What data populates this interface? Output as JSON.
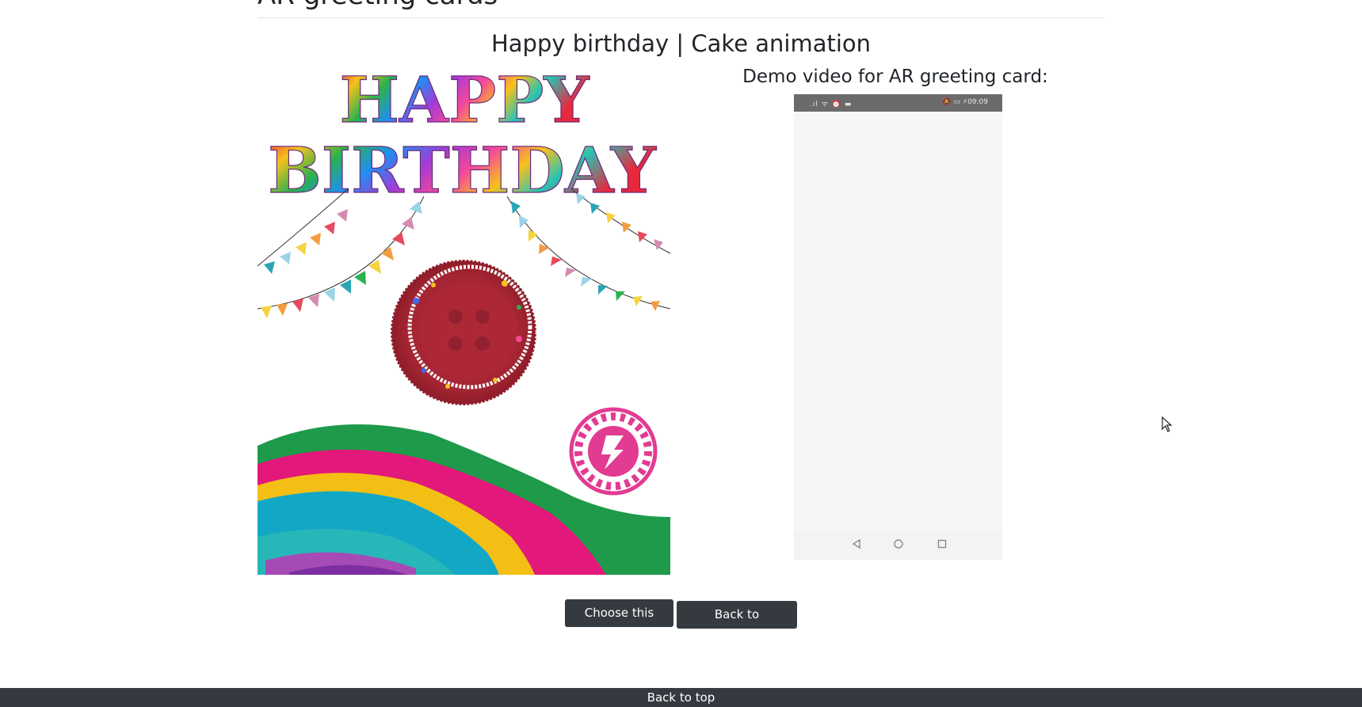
{
  "header": {
    "clipped_title": "AR greeting cards"
  },
  "page_title": "Happy birthday | Cake animation",
  "card_image": {
    "headline_line1": "HAPPY",
    "headline_line2": "BIRTHDAY"
  },
  "demo": {
    "title": "Demo video for AR greeting card:",
    "phone_status_left": ".ıl ᯤ ⏰ ▬",
    "phone_status_right": "🔕 ▭ ⚡09:09"
  },
  "buttons": {
    "choose_label": "Choose this card",
    "home_label": "Back to homepage"
  },
  "footer": {
    "back_to_top": "Back to top"
  },
  "colors": {
    "dark": "#343a40",
    "text": "#212529",
    "rule": "#dee2e6"
  }
}
